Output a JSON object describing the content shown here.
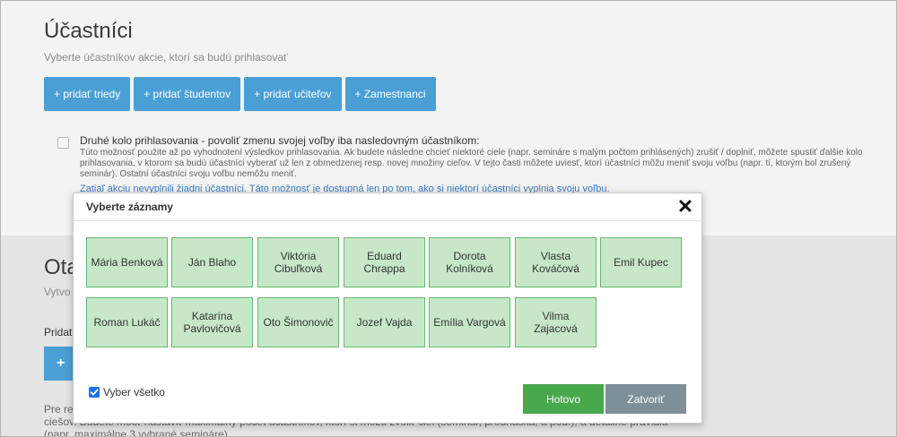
{
  "participants": {
    "title": "Účastníci",
    "subtitle": "Vyberte účastníkov akcie, ktorí sa budú prihlasovať",
    "buttons": [
      "+ pridať triedy",
      "+ pridať študentov",
      "+ pridať učiteľov",
      "+ Zamestnanci"
    ],
    "second_round": {
      "checked": false,
      "label": "Druhé kolo prihlasovania - povoliť zmenu svojej voľby iba nasledovným účastníkom:",
      "description": "Túto možnosť použite až po vyhodnotení výsledkov prihlasovania. Ak budete následne chcieť niektoré ciele (napr. semináre s malým počtom prihlásených) zrušiť / doplniť, môžete spustiť ďalšie kolo prihlasovania, v ktorom sa budú účastníci vyberať už len z obmedzenej resp. novej množiny cieľov. V tejto časti môžete uviesť, ktorí účastníci môžu meniť svoju voľbu (napr. tí, ktorým bol zrušený seminár). Ostatní účastníci svoju voľbu nemôžu meniť.",
      "note": "Zatiaľ akciu nevyplnili žiadni účastníci. Táto možnosť je dostupná len po tom, ako si niektorí účastníci vyplnia svoju voľbu."
    }
  },
  "section2": {
    "title_partial": "Ota",
    "subtitle_partial": "Vytvo",
    "label_partial": "Pridat",
    "button_partial": "+",
    "paragraph_partial": "Pre re\nciešov. Budete môcť nastaviť maximálny počet účastníkov, ktorí si môžu zvoliť ciel (seminár, prednáška, a pod.), a detailné pravidlá\n(napr. maximálne 3 vybrané semináre)"
  },
  "modal": {
    "title": "Vyberte záznamy",
    "close_icon": "close-icon",
    "records": [
      "Mária Benková",
      "Ján Blaho",
      "Viktória Cibuľková",
      "Eduard Chrappa",
      "Dorota Kolníková",
      "Vlasta Kováčová",
      "Emil Kupec",
      "Roman Lukáč",
      "Katarína Pavlovičová",
      "Oto Šimonovič",
      "Jozef Vajda",
      "Emília Vargová",
      "Vilma Zajacová"
    ],
    "select_all": {
      "label": "Vyber všetko",
      "checked": true
    },
    "done_label": "Hotovo",
    "close_label": "Zatvoriť"
  },
  "colors": {
    "accent_blue": "#4a9fd5",
    "card_fill": "#c6e8c9",
    "card_border": "#67b76b",
    "done_green": "#47a84c",
    "close_gray": "#7f8f99"
  }
}
